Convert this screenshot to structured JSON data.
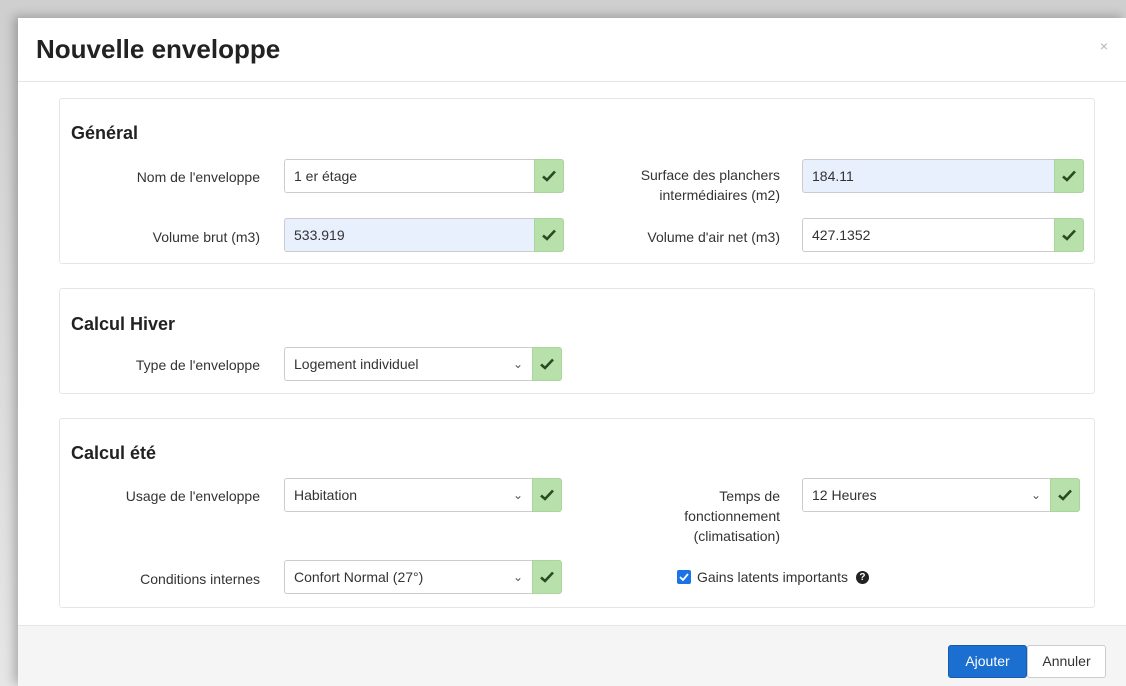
{
  "dialog": {
    "title": "Nouvelle enveloppe",
    "close": "×"
  },
  "general": {
    "title": "Général",
    "name_label": "Nom de l'enveloppe",
    "name_value": "1 er étage",
    "surface_label_1": "Surface des planchers",
    "surface_label_2": "intermédiaires (m2)",
    "surface_value": "184.11",
    "volume_brut_label": "Volume brut (m3)",
    "volume_brut_value": "533.919",
    "volume_air_label": "Volume d'air net (m3)",
    "volume_air_value": "427.1352"
  },
  "hiver": {
    "title": "Calcul Hiver",
    "type_label": "Type de l'enveloppe",
    "type_value": "Logement individuel"
  },
  "ete": {
    "title": "Calcul été",
    "usage_label": "Usage de l'enveloppe",
    "usage_value": "Habitation",
    "temps_label_1": "Temps de",
    "temps_label_2": "fonctionnement",
    "temps_label_3": "(climatisation)",
    "temps_value": "12 Heures",
    "conditions_label": "Conditions internes",
    "conditions_value": "Confort Normal (27°)",
    "gains_label": "Gains latents importants",
    "gains_checked": true
  },
  "footer": {
    "add_label": "Ajouter",
    "cancel_label": "Annuler"
  },
  "colors": {
    "primary": "#1a6fd0",
    "valid": "#b8e0ab",
    "autofill": "#e8f0fe"
  }
}
